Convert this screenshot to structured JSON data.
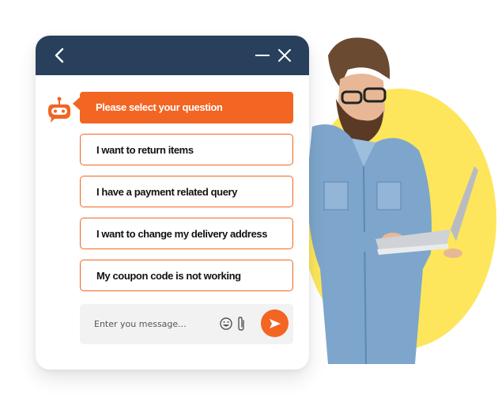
{
  "colors": {
    "header": "#28405c",
    "accent": "#f26522",
    "composer_bg": "#f2f2f2",
    "hero_circle": "#fde65c"
  },
  "header": {
    "back_icon": "chevron-left-icon",
    "minimize_icon": "minimize-icon",
    "close_icon": "close-icon"
  },
  "bot": {
    "icon": "robot-icon",
    "prompt": "Please select your question"
  },
  "options": [
    {
      "label": "I want to return items"
    },
    {
      "label": "I have a payment related query"
    },
    {
      "label": "I want to change my delivery address"
    },
    {
      "label": "My coupon code is not working"
    }
  ],
  "composer": {
    "placeholder": "Enter you message...",
    "value": "",
    "emoji_icon": "emoji-icon",
    "attach_icon": "paperclip-icon",
    "send_icon": "send-icon"
  },
  "illustration": {
    "description": "Man with glasses and denim shirt holding a laptop in front of a yellow circle"
  }
}
